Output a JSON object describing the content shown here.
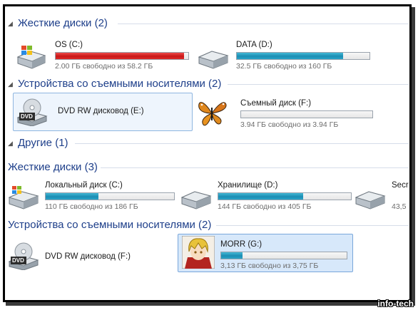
{
  "sections": [
    {
      "label": "Жесткие диски (2)"
    },
    {
      "label": "Устройства со съемными носителями (2)"
    },
    {
      "label": "Другие (1)"
    },
    {
      "label": "Жесткие диски (3)"
    },
    {
      "label": "Устройства со съемными носителями (2)"
    }
  ],
  "drives": {
    "os": {
      "name": "OS (C:)",
      "free": "2.00 ГБ свободно из 58.2 ГБ",
      "used_fraction": 0.97
    },
    "data": {
      "name": "DATA (D:)",
      "free": "32.5 ГБ свободно из 160 ГБ",
      "used_fraction": 0.8
    },
    "dvd1": {
      "name": "DVD RW дисковод (E:)",
      "disc_label": "DVD"
    },
    "removable": {
      "name": "Съемный диск (F:)",
      "free": "3.94 ГБ свободно из 3.94 ГБ",
      "used_fraction": 0.0
    },
    "local_c": {
      "name": "Локальный диск (C:)",
      "free": "110 ГБ свободно из 186 ГБ",
      "used_fraction": 0.41
    },
    "store_d": {
      "name": "Хранилище (D:)",
      "free": "144 ГБ свободно из 405 ГБ",
      "used_fraction": 0.64
    },
    "secr": {
      "name": "Secr",
      "free": "43,5"
    },
    "dvd2": {
      "name": "DVD RW дисковод (F:)",
      "disc_label": "DVD"
    },
    "morr": {
      "name": "MORR (G:)",
      "free": "3,13 ГБ свободно из 3,75 ГБ",
      "used_fraction": 0.17
    }
  },
  "watermark": "info-tech",
  "colors": {
    "header": "#1e3f8a",
    "bar_blue": "#1c8db3",
    "bar_red": "#c81818",
    "selection": "#d7e8fa"
  }
}
